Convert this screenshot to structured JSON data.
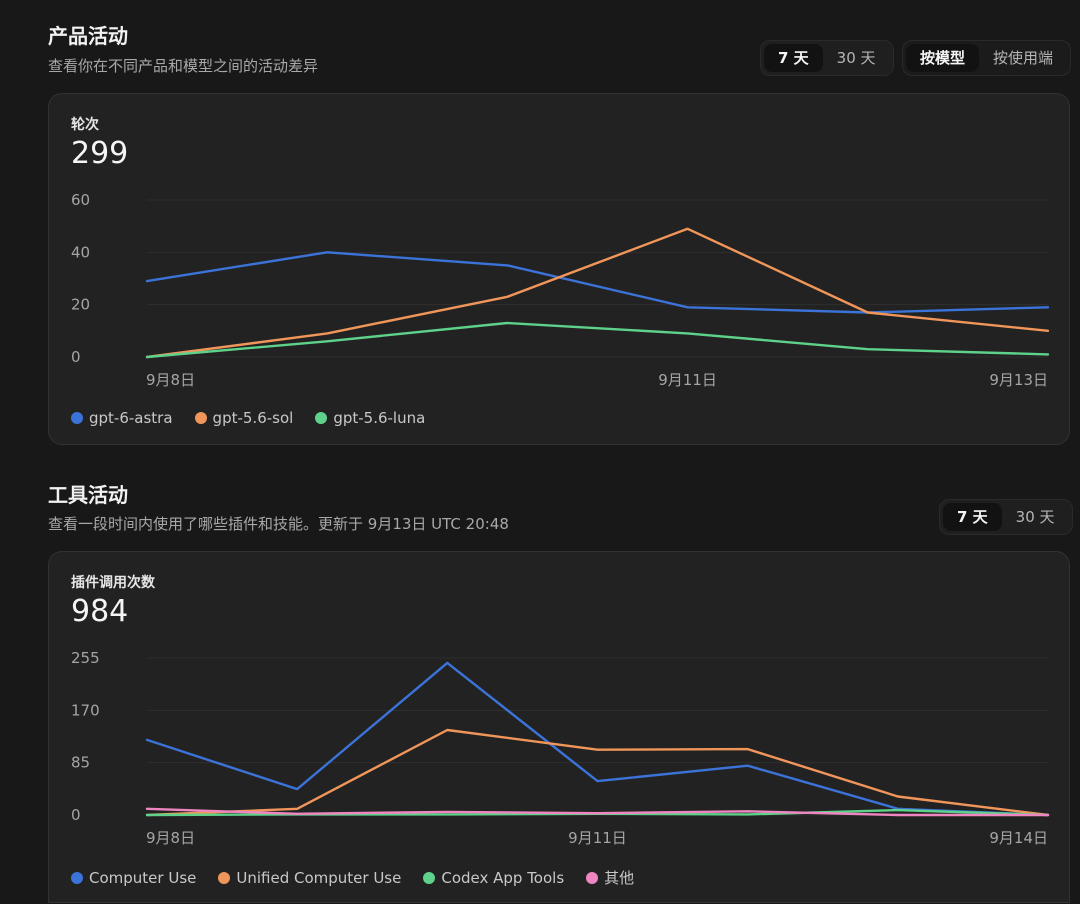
{
  "product": {
    "title": "产品活动",
    "subtitle": "查看你在不同产品和模型之间的活动差异",
    "range_tabs": [
      {
        "label": "7 天",
        "active": true
      },
      {
        "label": "30 天",
        "active": false
      }
    ],
    "group_tabs": [
      {
        "label": "按模型",
        "active": true
      },
      {
        "label": "按使用端",
        "active": false
      }
    ],
    "metric_label": "轮次",
    "metric_value": "299"
  },
  "tools": {
    "title": "工具活动",
    "subtitle": "查看一段时间内使用了哪些插件和技能。更新于 9月13日 UTC 20:48",
    "range_tabs": [
      {
        "label": "7 天",
        "active": true
      },
      {
        "label": "30 天",
        "active": false
      }
    ],
    "metric_label": "插件调用次数",
    "metric_value": "984"
  },
  "chart_data": [
    {
      "type": "line",
      "x": [
        "9月8日",
        "9月9日",
        "9月10日",
        "9月11日",
        "9月12日",
        "9月13日"
      ],
      "xtick_labels": [
        "9月8日",
        "9月11日",
        "9月13日"
      ],
      "yticks": [
        0,
        20,
        40,
        60
      ],
      "ylim": [
        0,
        60
      ],
      "grid": true,
      "legend_position": "bottom-left",
      "series": [
        {
          "name": "gpt-6-astra",
          "color": "#3b73d9",
          "values": [
            29,
            40,
            35,
            19,
            17,
            19
          ]
        },
        {
          "name": "gpt-5.6-sol",
          "color": "#f0965a",
          "values": [
            0,
            9,
            23,
            49,
            17,
            10
          ]
        },
        {
          "name": "gpt-5.6-luna",
          "color": "#5ed28a",
          "values": [
            0,
            6,
            13,
            9,
            3,
            1
          ]
        }
      ]
    },
    {
      "type": "line",
      "x": [
        "9月8日",
        "9月9日",
        "9月10日",
        "9月11日",
        "9月12日",
        "9月13日",
        "9月14日"
      ],
      "xtick_labels": [
        "9月8日",
        "9月11日",
        "9月14日"
      ],
      "yticks": [
        0,
        85,
        170,
        255
      ],
      "ylim": [
        0,
        255
      ],
      "grid": true,
      "legend_position": "bottom-left",
      "series": [
        {
          "name": "Computer Use",
          "color": "#3b73d9",
          "values": [
            122,
            42,
            247,
            55,
            80,
            10,
            0
          ]
        },
        {
          "name": "Unified Computer Use",
          "color": "#f0965a",
          "values": [
            0,
            10,
            138,
            106,
            107,
            30,
            0
          ]
        },
        {
          "name": "Codex App Tools",
          "color": "#5ed28a",
          "values": [
            0,
            1,
            1,
            2,
            1,
            8,
            0
          ]
        },
        {
          "name": "其他",
          "color": "#ef86c1",
          "values": [
            10,
            2,
            5,
            3,
            6,
            0,
            0
          ]
        }
      ]
    }
  ]
}
